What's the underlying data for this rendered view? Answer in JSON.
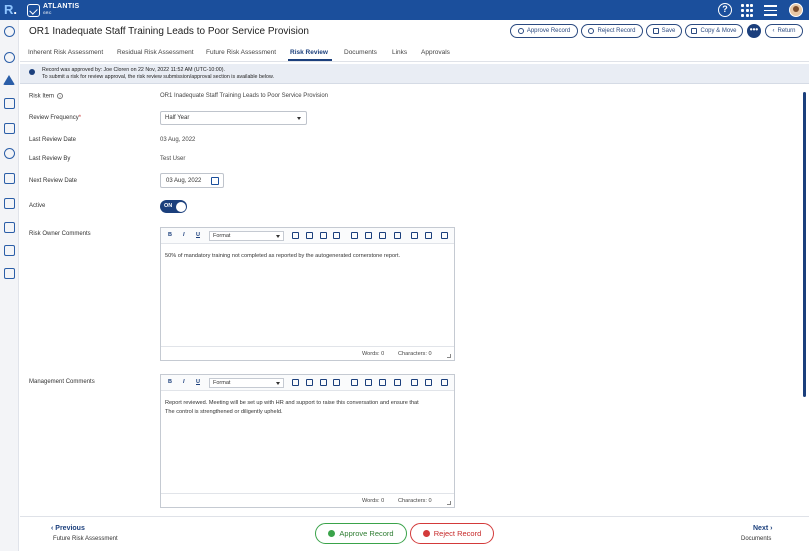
{
  "app": {
    "logo": "R",
    "brand_name": "ATLANTIS",
    "brand_sub": "GRC"
  },
  "header": {
    "title": "OR1 Inadequate Staff Training Leads to Poor Service Provision",
    "buttons": {
      "approve": "Approve Record",
      "reject": "Reject Record",
      "save": "Save",
      "copy_move": "Copy & Move",
      "more": "•••",
      "return": "Return"
    }
  },
  "tabs": [
    {
      "label": "Inherent Risk Assessment"
    },
    {
      "label": "Residual Risk Assessment"
    },
    {
      "label": "Future Risk Assessment"
    },
    {
      "label": "Risk Review"
    },
    {
      "label": "Documents"
    },
    {
      "label": "Links"
    },
    {
      "label": "Approvals"
    }
  ],
  "banner": {
    "line1": "Record was approved by: Joe Cloren on 22 Nov, 2022 11:52 AM (UTC-10:00).",
    "line2": "To submit a risk for review approval, the risk review submission/approval section is available below."
  },
  "form": {
    "risk_item_label": "Risk Item",
    "risk_item_value": "OR1 Inadequate Staff Training Leads to Poor Service Provision",
    "review_frequency_label": "Review Frequency",
    "review_frequency_value": "Half Year",
    "last_review_date_label": "Last Review Date",
    "last_review_date_value": "03 Aug, 2022",
    "last_review_by_label": "Last Review By",
    "last_review_by_value": "Test User",
    "next_review_date_label": "Next Review Date",
    "next_review_date_value": "03 Aug, 2022",
    "active_label": "Active",
    "active_value": "ON",
    "risk_owner_comments_label": "Risk Owner Comments",
    "management_comments_label": "Management Comments"
  },
  "editors": {
    "format_label": "Format",
    "bold": "B",
    "italic": "I",
    "underline": "U",
    "owner": {
      "text": "50% of mandatory training not completed as reported by the autogenerated cornerstone report.",
      "words": "Words: 0",
      "chars": "Characters: 0"
    },
    "management": {
      "text_line1": "Report reviewed. Meeting will be set up with HR and support to raise this conversation and ensure that",
      "text_line2": "The control is strengthened or diligently upheld.",
      "words": "Words: 0",
      "chars": "Characters: 0"
    }
  },
  "footer": {
    "prev_label": "Previous",
    "prev_sub": "Future Risk Assessment",
    "next_label": "Next",
    "next_sub": "Documents",
    "approve": "Approve Record",
    "reject": "Reject Record"
  },
  "colors": {
    "primary": "#1b4f9c",
    "dark_primary": "#1b3f7c",
    "approve_green": "#3aa34a",
    "reject_red": "#d33a3a"
  }
}
